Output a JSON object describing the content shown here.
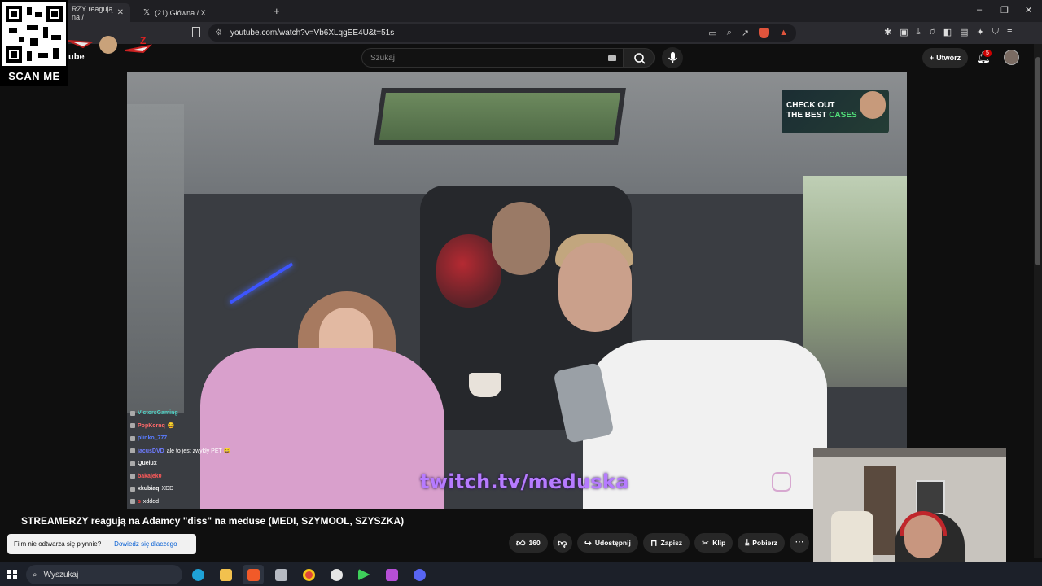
{
  "browser": {
    "tabs": [
      {
        "label": "RZY reagują na /",
        "active": true
      },
      {
        "label": "(21) Główna / X",
        "active": false
      }
    ],
    "new_tab": "+",
    "url": "youtube.com/watch?v=Vb6XLqgEE4U&t=51s",
    "window_controls": [
      "–",
      "❐",
      "✕"
    ]
  },
  "overlay": {
    "qr_label": "SCAN ME",
    "yt_logo_fragment": "ube"
  },
  "youtube": {
    "search_placeholder": "Szukaj",
    "create_label": "Utwórz",
    "notification_count": "5"
  },
  "video": {
    "promo": {
      "line1": "CHECK OUT",
      "line2_a": "THE BEST ",
      "line2_b": "CASES"
    },
    "twitch_text": "twitch.tv/meduska",
    "chat": [
      {
        "user": "VictorsGaming",
        "msg": "",
        "color": "#4fd1c5"
      },
      {
        "user": "PopKornq",
        "msg": "😄",
        "color": "#ff6a6a"
      },
      {
        "user": "plinko_777",
        "msg": "",
        "color": "#5a7cff"
      },
      {
        "user": "jacusDVD",
        "msg": "ale to jest zwykły PET 😄",
        "color": "#6f7cff"
      },
      {
        "user": "Quelux",
        "msg": "",
        "color": "#f4f4f4"
      },
      {
        "user": "bakajek0",
        "msg": "",
        "color": "#ff5a5a"
      },
      {
        "user": "xkubiaq",
        "msg": "XDD",
        "color": "#f4f4f4"
      },
      {
        "user": "s",
        "msg": "xdddd",
        "color": "#ff3b3b"
      }
    ]
  },
  "meta": {
    "title": "STREAMERZY reagują na Adamcy \"diss\" na meduse (MEDI, SZYMOOL, SZYSZKA)",
    "likes": "160",
    "share": "Udostępnij",
    "save": "Zapisz",
    "clip": "Klip",
    "download": "Pobierz"
  },
  "toast": {
    "text": "Film nie odtwarza się płynnie?",
    "link": "Dowiedz się dlaczego"
  },
  "taskbar": {
    "search_placeholder": "Wyszukaj"
  }
}
